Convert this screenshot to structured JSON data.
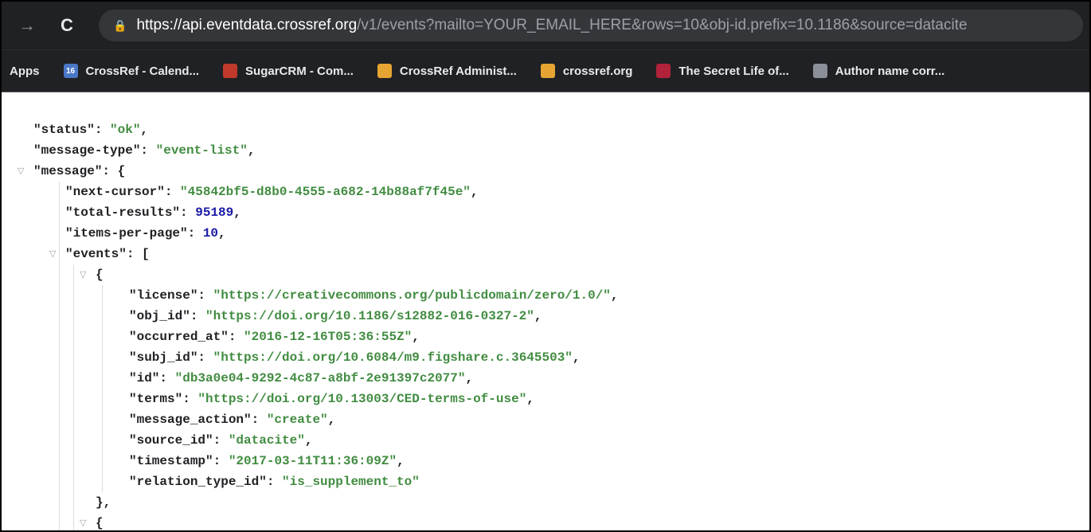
{
  "browser": {
    "url_host": "https://api.eventdata.crossref.org",
    "url_path": "/v1/events?mailto=YOUR_EMAIL_HERE&rows=10&obj-id.prefix=10.1186&source=datacite",
    "icons": {
      "back": "back-arrow-icon",
      "reload": "reload-icon",
      "lock": "lock-icon"
    },
    "colors": {
      "toolbar": "#202124",
      "omnibox": "#35363a"
    }
  },
  "bookmarks": {
    "apps_label": "Apps",
    "items": [
      {
        "label": "CrossRef - Calend...",
        "icon": "calendar-icon",
        "color": "#4a78c8",
        "glyph": "16"
      },
      {
        "label": "SugarCRM - Com...",
        "icon": "sugarcrm-cube-icon",
        "color": "#c0392b",
        "glyph": ""
      },
      {
        "label": "CrossRef Administ...",
        "icon": "crossref-logo-icon",
        "color": "#e6a532",
        "glyph": ""
      },
      {
        "label": "crossref.org",
        "icon": "crossref-logo-icon",
        "color": "#e6a532",
        "glyph": ""
      },
      {
        "label": "The Secret Life of...",
        "icon": "bookmark-red-icon",
        "color": "#b0233a",
        "glyph": ""
      },
      {
        "label": "Author name corr...",
        "icon": "document-thumbnail-icon",
        "color": "#8a8f99",
        "glyph": ""
      }
    ]
  },
  "json_view": {
    "colors": {
      "key": "#202124",
      "string": "#418c41",
      "number": "#1a1aa6"
    },
    "lines": [
      {
        "indent": 0,
        "key": "\"status\"",
        "value": "\"ok\"",
        "vtype": "s",
        "trail": ","
      },
      {
        "indent": 0,
        "key": "\"message-type\"",
        "value": "\"event-list\"",
        "vtype": "s",
        "trail": ","
      },
      {
        "indent": 0,
        "key": "\"message\"",
        "value": "",
        "vtype": "p",
        "trail": "{",
        "toggle": true
      },
      {
        "indent": 1,
        "key": "\"next-cursor\"",
        "value": "\"45842bf5-d8b0-4555-a682-14b88af7f45e\"",
        "vtype": "s",
        "trail": ","
      },
      {
        "indent": 1,
        "key": "\"total-results\"",
        "value": "95189",
        "vtype": "n",
        "trail": ","
      },
      {
        "indent": 1,
        "key": "\"items-per-page\"",
        "value": "10",
        "vtype": "n",
        "trail": ","
      },
      {
        "indent": 1,
        "key": "\"events\"",
        "value": "",
        "vtype": "p",
        "trail": "[",
        "toggle": true
      },
      {
        "indent": 2,
        "key": "",
        "value": "",
        "vtype": "p",
        "trail": "{",
        "toggle": true
      },
      {
        "indent": 3,
        "key": "\"license\"",
        "value": "\"https://creativecommons.org/publicdomain/zero/1.0/\"",
        "vtype": "s",
        "trail": ","
      },
      {
        "indent": 3,
        "key": "\"obj_id\"",
        "value": "\"https://doi.org/10.1186/s12882-016-0327-2\"",
        "vtype": "s",
        "trail": ","
      },
      {
        "indent": 3,
        "key": "\"occurred_at\"",
        "value": "\"2016-12-16T05:36:55Z\"",
        "vtype": "s",
        "trail": ","
      },
      {
        "indent": 3,
        "key": "\"subj_id\"",
        "value": "\"https://doi.org/10.6084/m9.figshare.c.3645503\"",
        "vtype": "s",
        "trail": ","
      },
      {
        "indent": 3,
        "key": "\"id\"",
        "value": "\"db3a0e04-9292-4c87-a8bf-2e91397c2077\"",
        "vtype": "s",
        "trail": ","
      },
      {
        "indent": 3,
        "key": "\"terms\"",
        "value": "\"https://doi.org/10.13003/CED-terms-of-use\"",
        "vtype": "s",
        "trail": ","
      },
      {
        "indent": 3,
        "key": "\"message_action\"",
        "value": "\"create\"",
        "vtype": "s",
        "trail": ","
      },
      {
        "indent": 3,
        "key": "\"source_id\"",
        "value": "\"datacite\"",
        "vtype": "s",
        "trail": ","
      },
      {
        "indent": 3,
        "key": "\"timestamp\"",
        "value": "\"2017-03-11T11:36:09Z\"",
        "vtype": "s",
        "trail": ","
      },
      {
        "indent": 3,
        "key": "\"relation_type_id\"",
        "value": "\"is_supplement_to\"",
        "vtype": "s",
        "trail": ""
      },
      {
        "indent": 2,
        "key": "",
        "value": "",
        "vtype": "p",
        "trail": "},"
      },
      {
        "indent": 2,
        "key": "",
        "value": "",
        "vtype": "p",
        "trail": "{",
        "toggle": true
      }
    ]
  }
}
